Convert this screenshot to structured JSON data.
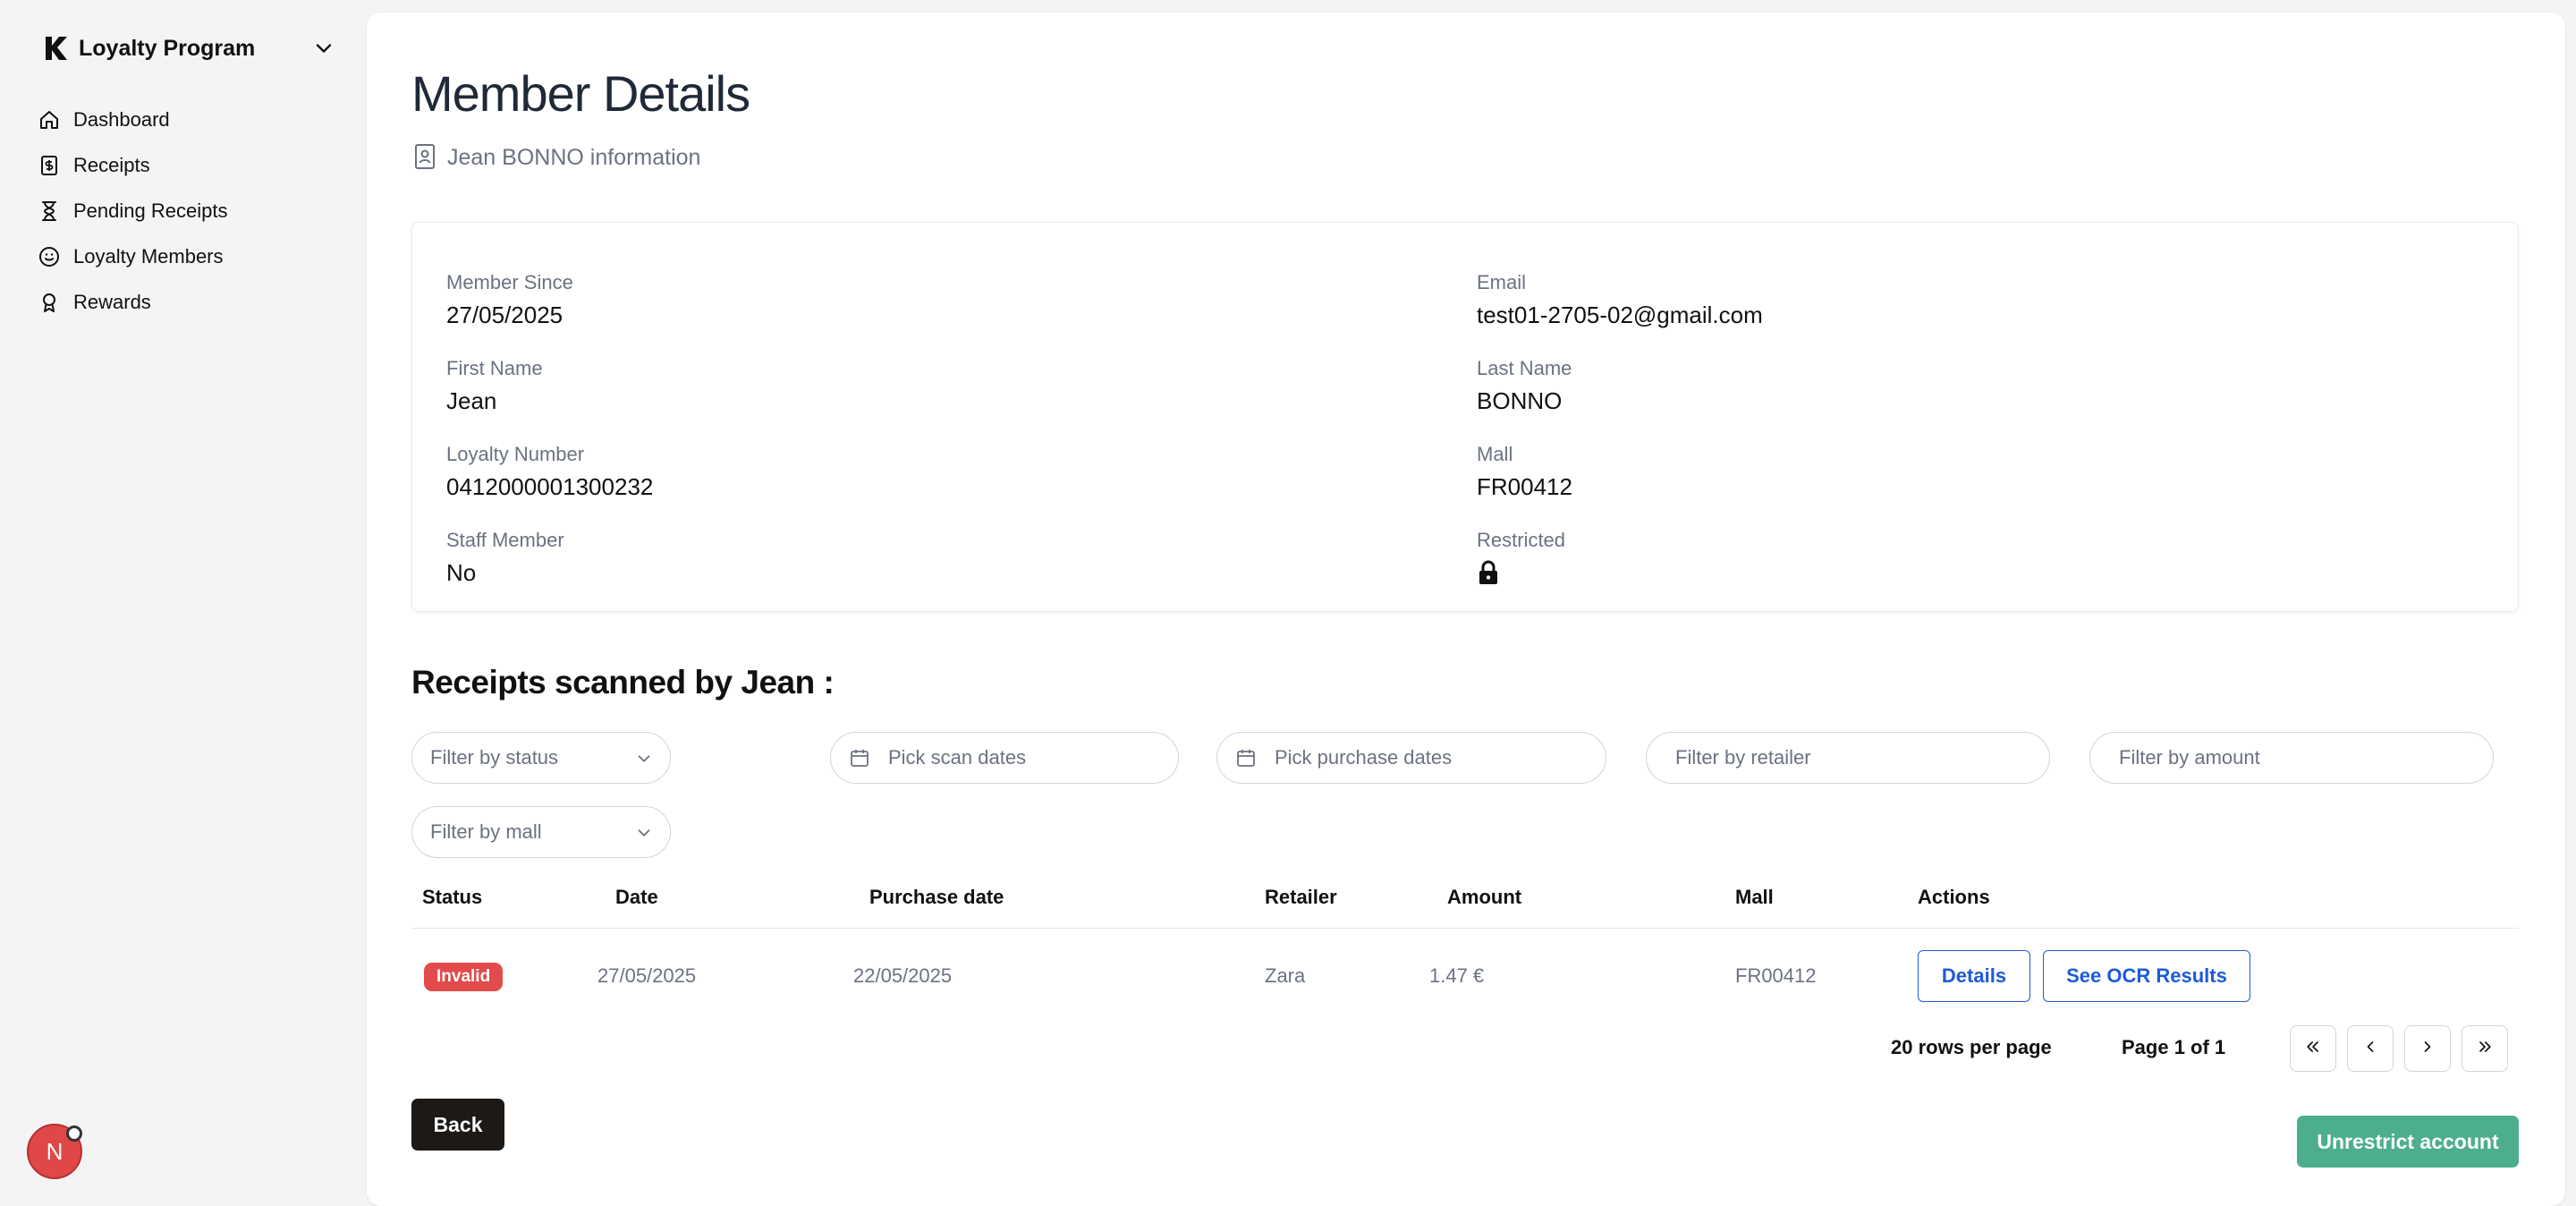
{
  "sidebar": {
    "brand_title": "Loyalty Program",
    "items": [
      {
        "label": "Dashboard",
        "icon": "home-icon"
      },
      {
        "label": "Receipts",
        "icon": "dollar-receipt-icon"
      },
      {
        "label": "Pending Receipts",
        "icon": "hourglass-icon"
      },
      {
        "label": "Loyalty Members",
        "icon": "smile-icon"
      },
      {
        "label": "Rewards",
        "icon": "award-icon"
      }
    ],
    "avatar_initial": "N"
  },
  "header": {
    "title": "Member Details",
    "subtitle": "Jean BONNO information"
  },
  "member": {
    "member_since_label": "Member Since",
    "member_since": "27/05/2025",
    "email_label": "Email",
    "email": "test01-2705-02@gmail.com",
    "first_name_label": "First Name",
    "first_name": "Jean",
    "last_name_label": "Last Name",
    "last_name": "BONNO",
    "loyalty_number_label": "Loyalty Number",
    "loyalty_number": "0412000001300232",
    "mall_label": "Mall",
    "mall": "FR00412",
    "staff_label": "Staff Member",
    "staff": "No",
    "restricted_label": "Restricted",
    "restricted_icon": "lock-icon"
  },
  "receipts": {
    "section_title": "Receipts scanned by Jean :",
    "filters": {
      "status": "Filter by status",
      "scan_dates": "Pick scan dates",
      "purchase_dates": "Pick purchase dates",
      "retailer": "Filter by retailer",
      "amount": "Filter by amount",
      "mall": "Filter by mall"
    },
    "columns": [
      "Status",
      "Date",
      "Purchase date",
      "Retailer",
      "Amount",
      "Mall",
      "Actions"
    ],
    "rows": [
      {
        "status": "Invalid",
        "date": "27/05/2025",
        "purchase_date": "22/05/2025",
        "retailer": "Zara",
        "amount": "1.47 €",
        "mall": "FR00412",
        "details_label": "Details",
        "ocr_label": "See OCR Results"
      }
    ],
    "rows_per_page": "20 rows per page",
    "page_info": "Page 1 of 1"
  },
  "actions": {
    "back_label": "Back",
    "unrestrict_label": "Unrestrict account"
  },
  "colors": {
    "invalid_badge": "#e24b4b",
    "accent_blue": "#1d5bd8",
    "unrestrict_green": "#4cae8f",
    "back_dark": "#1c1917"
  }
}
